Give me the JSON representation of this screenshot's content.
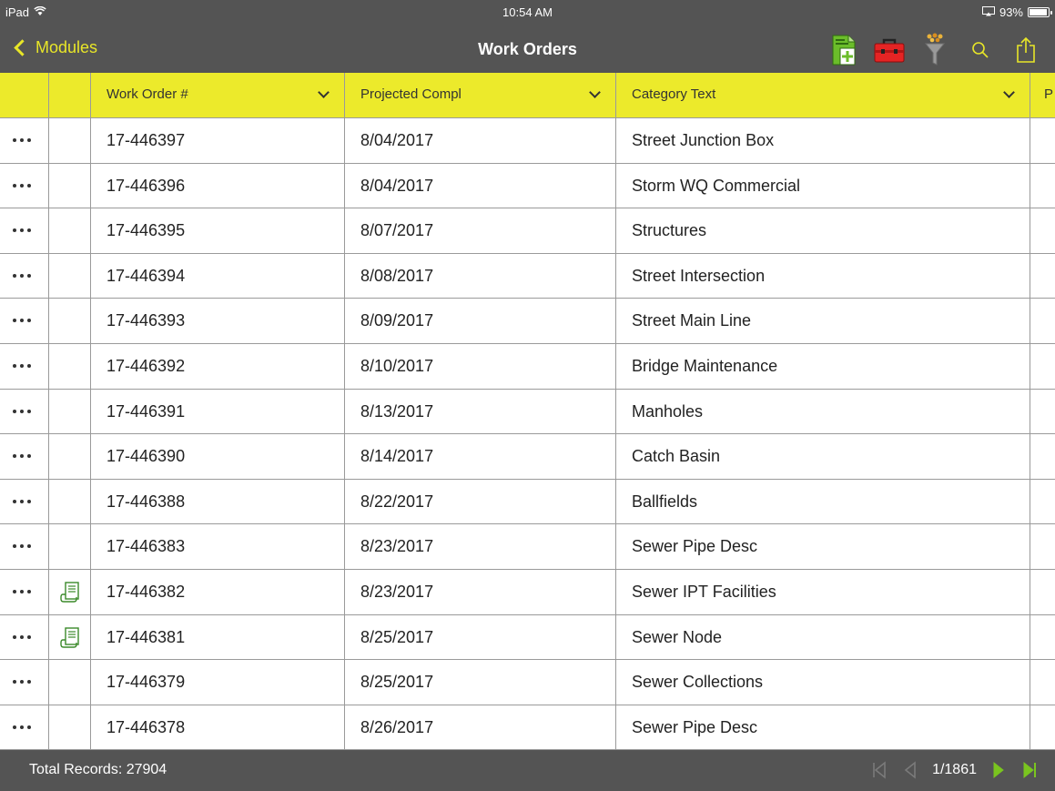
{
  "status_bar": {
    "device": "iPad",
    "time": "10:54 AM",
    "battery": "93%",
    "battery_level": 0.93
  },
  "nav": {
    "back_label": "Modules",
    "title": "Work Orders",
    "actions": [
      "new-record-icon",
      "toolbox-icon",
      "filter-icon",
      "search-icon",
      "share-icon"
    ]
  },
  "columns": [
    "",
    "",
    "Work Order #",
    "Projected Compl",
    "Category Text",
    "P"
  ],
  "rows": [
    {
      "wo": "17-446397",
      "date": "8/04/2017",
      "category": "Street Junction Box",
      "attachment": false
    },
    {
      "wo": "17-446396",
      "date": "8/04/2017",
      "category": "Storm WQ Commercial",
      "attachment": false
    },
    {
      "wo": "17-446395",
      "date": "8/07/2017",
      "category": "Structures",
      "attachment": false
    },
    {
      "wo": "17-446394",
      "date": "8/08/2017",
      "category": "Street Intersection",
      "attachment": false
    },
    {
      "wo": "17-446393",
      "date": "8/09/2017",
      "category": "Street Main Line",
      "attachment": false
    },
    {
      "wo": "17-446392",
      "date": "8/10/2017",
      "category": "Bridge Maintenance",
      "attachment": false
    },
    {
      "wo": "17-446391",
      "date": "8/13/2017",
      "category": "Manholes",
      "attachment": false
    },
    {
      "wo": "17-446390",
      "date": "8/14/2017",
      "category": "Catch Basin",
      "attachment": false
    },
    {
      "wo": "17-446388",
      "date": "8/22/2017",
      "category": "Ballfields",
      "attachment": false
    },
    {
      "wo": "17-446383",
      "date": "8/23/2017",
      "category": "Sewer Pipe Desc",
      "attachment": false
    },
    {
      "wo": "17-446382",
      "date": "8/23/2017",
      "category": "Sewer IPT Facilities",
      "attachment": true
    },
    {
      "wo": "17-446381",
      "date": "8/25/2017",
      "category": "Sewer Node",
      "attachment": true
    },
    {
      "wo": "17-446379",
      "date": "8/25/2017",
      "category": "Sewer Collections",
      "attachment": false
    },
    {
      "wo": "17-446378",
      "date": "8/26/2017",
      "category": "Sewer Pipe Desc",
      "attachment": false
    }
  ],
  "footer": {
    "total_label": "Total Records: 27904",
    "page": "1/1861"
  },
  "colors": {
    "bar": "#545454",
    "header": "#ecea2b",
    "accent_yellow": "#e8e628",
    "pager_green": "#7ac51f"
  }
}
